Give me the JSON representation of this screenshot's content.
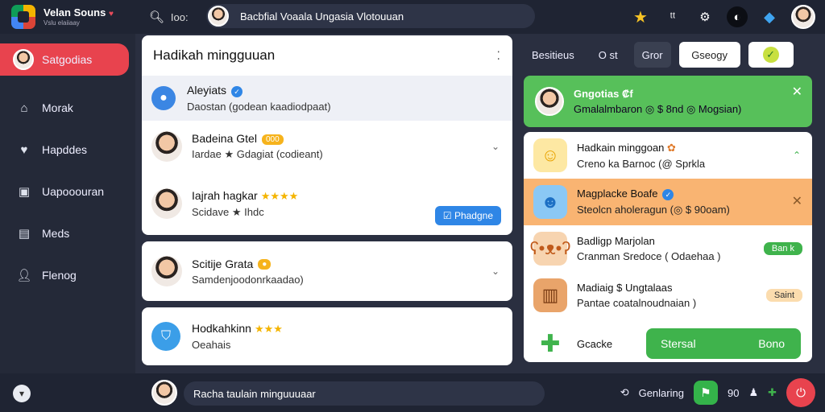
{
  "brand": {
    "name": "Velan Souns",
    "sub": "Vslu elaiiaay"
  },
  "search": {
    "query": "Ioo:",
    "text": "Bacbfial Voaala Ungasia Vlotouuan"
  },
  "sidebar": {
    "items": [
      {
        "label": "Satgodias",
        "icon": "avatar-icon"
      },
      {
        "label": "Morak",
        "icon": "home-icon"
      },
      {
        "label": "Hapddes",
        "icon": "heart-icon"
      },
      {
        "label": "Uapooouran",
        "icon": "photo-icon"
      },
      {
        "label": "Meds",
        "icon": "grid-icon"
      },
      {
        "label": "Flenog",
        "icon": "user-icon"
      }
    ]
  },
  "feed": {
    "title": "Hadikah mingguuan",
    "rows": [
      {
        "title": "Aleyiats",
        "subtitle": "Daostan (godean kaadiodpaat)"
      },
      {
        "title": "Badeina Gtel",
        "badge": "000",
        "subtitle": "Iardae ★ Gdagiat (codieant)"
      },
      {
        "title": "Iajrah hagkar",
        "subtitle": "Scidave ★ Ihdc"
      }
    ],
    "action_button": "Phadgne",
    "card2": {
      "title": "Scitije Grata",
      "subtitle": "Samdenjoodonrkaadao)"
    },
    "card3": {
      "title": "Hodkahkinn",
      "subtitle": "Oeahais"
    }
  },
  "right": {
    "tabs": [
      "Besitieus",
      "O st",
      "Gror",
      "Gseogy"
    ],
    "notification": {
      "title": "Gngotias ₡f",
      "subtitle": "Gmalalmbaron ◎ $ 8nd ◎ Mogsian)"
    },
    "list": [
      {
        "title": "Hadkain minggoan",
        "subtitle": "Creno ka Barnoc (@ Sprkla"
      },
      {
        "title": "Magplacke Boafe",
        "subtitle": "Steolcn aholeragun (◎ $ 90oam)"
      },
      {
        "title": "Badligp Marjolan",
        "subtitle": "Cranman Sredoce ( Odaehaa )",
        "pill": "Ban k"
      },
      {
        "title": "Madiaig $ Ungtalaas",
        "subtitle": "Pantae coatalnoudnaian )",
        "pill": "Saint"
      }
    ],
    "footer": {
      "label": "Gcacke",
      "btn_left": "Stersal",
      "btn_right": "Bono"
    }
  },
  "bottom": {
    "input": "Racha taulain minguuuaar",
    "status": "Genlaring",
    "count": "90"
  },
  "colors": {
    "accent_red": "#e8434e",
    "accent_green": "#57c05a",
    "accent_orange": "#f9b472",
    "accent_blue": "#2f86e6"
  }
}
